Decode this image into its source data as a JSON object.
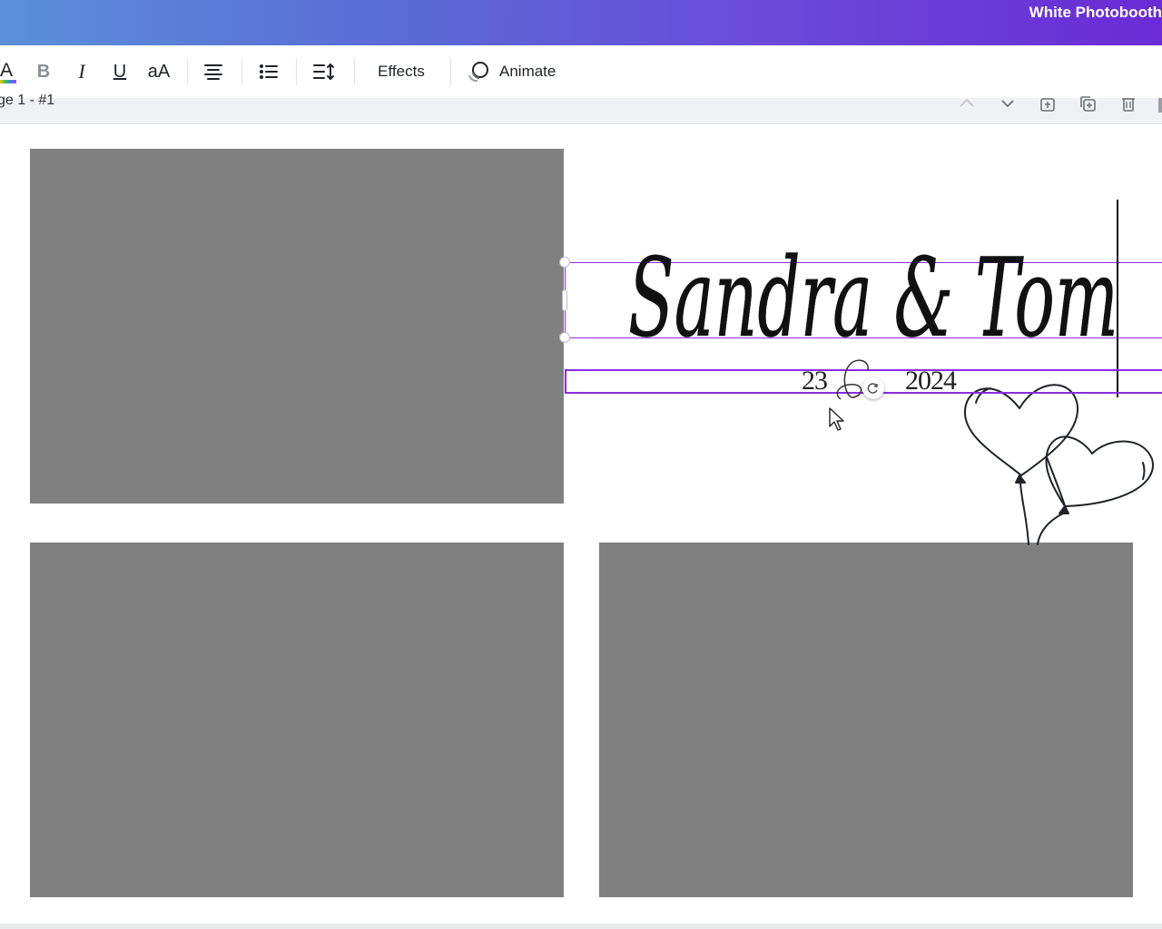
{
  "header": {
    "title": "White Photobooth"
  },
  "toolbar": {
    "text_color_label": "A",
    "bold_label": "B",
    "italic_label": "I",
    "underline_label": "U",
    "case_label": "aA",
    "effects_label": "Effects",
    "animate_label": "Animate",
    "icons": [
      "text-color-icon",
      "bold-icon",
      "italic-icon",
      "underline-icon",
      "letter-case-icon",
      "align-center-icon",
      "bullet-list-icon",
      "line-spacing-icon",
      "animate-icon"
    ]
  },
  "page": {
    "label": "ge 1 - #1",
    "icons": [
      "chevron-up-icon",
      "chevron-down-icon",
      "add-page-icon",
      "duplicate-page-icon",
      "delete-page-icon"
    ]
  },
  "canvas": {
    "title_text": "Sandra & Tom",
    "date_day": "23",
    "date_year": "2024",
    "photo_placeholders": 3,
    "decoration": "heart-balloons",
    "colors": {
      "selection": "#8a2be2",
      "placeholder": "#808080"
    }
  }
}
